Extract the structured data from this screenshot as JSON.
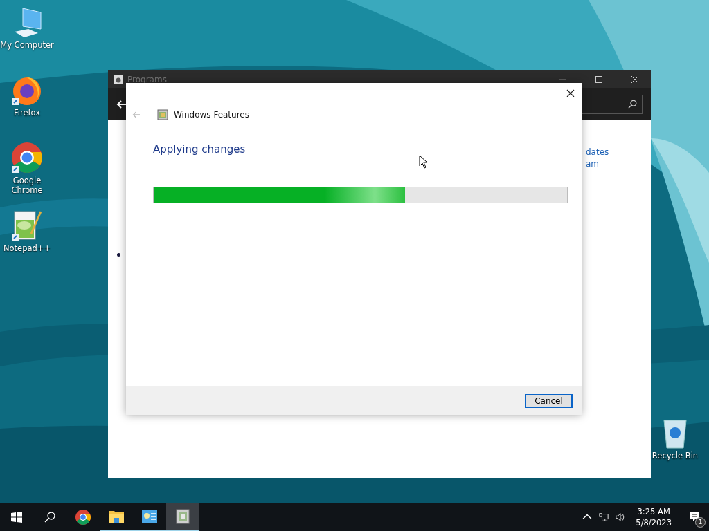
{
  "desktop_icons": [
    {
      "kind": "computer",
      "label": "My Computer"
    },
    {
      "kind": "firefox",
      "label": "Firefox"
    },
    {
      "kind": "chrome",
      "label": "Google Chrome"
    },
    {
      "kind": "notepad",
      "label": "Notepad++"
    }
  ],
  "recycle_bin": {
    "label": "Recycle Bin"
  },
  "background_window": {
    "title": "Programs",
    "links": [
      "dates",
      "am"
    ]
  },
  "dialog": {
    "title": "Windows Features",
    "heading": "Applying changes",
    "progress": {
      "level": 0.608
    },
    "buttons": [
      "Cancel"
    ]
  },
  "taskbar": {
    "apps": [
      {
        "kind": "chrome",
        "running": false,
        "selected": false
      },
      {
        "kind": "folder",
        "running": true,
        "selected": false
      },
      {
        "kind": "control",
        "running": true,
        "selected": false
      },
      {
        "kind": "features",
        "running": true,
        "selected": true
      }
    ],
    "time": "3:25 AM",
    "date": "5/8/2023",
    "notification_count": "1"
  }
}
